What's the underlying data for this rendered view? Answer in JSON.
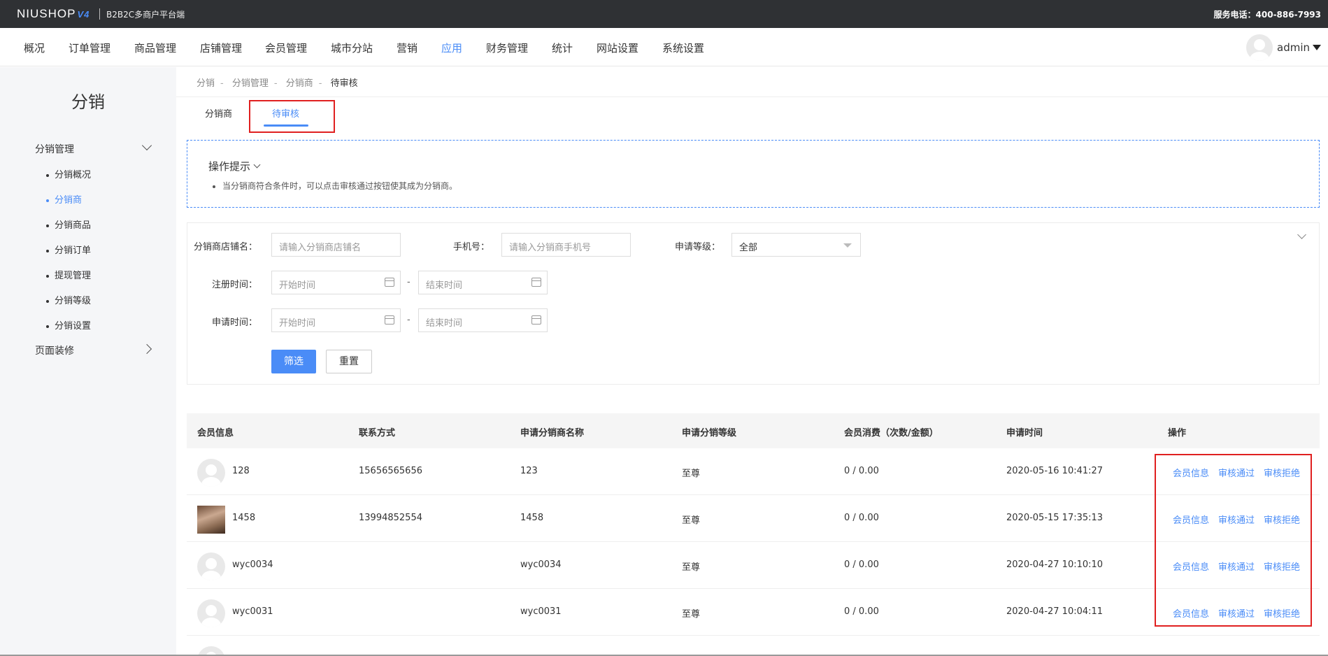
{
  "topbar": {
    "logo": "NIUSHOP",
    "logo_version": "V4",
    "subtitle": "B2B2C多商户平台端",
    "hotline": "服务电话：400-886-7993"
  },
  "nav": {
    "items": [
      "概况",
      "订单管理",
      "商品管理",
      "店铺管理",
      "会员管理",
      "城市分站",
      "营销",
      "应用",
      "财务管理",
      "统计",
      "网站设置",
      "系统设置"
    ],
    "active": "应用",
    "user": "admin"
  },
  "sidebar": {
    "title": "分销",
    "groups": [
      {
        "label": "分销管理",
        "expanded": true,
        "items": [
          "分销概况",
          "分销商",
          "分销商品",
          "分销订单",
          "提现管理",
          "分销等级",
          "分销设置"
        ],
        "active": "分销商"
      },
      {
        "label": "页面装修",
        "expanded": false
      }
    ]
  },
  "breadcrumb": [
    "分销",
    "分销管理",
    "分销商",
    "待审核"
  ],
  "tabs": {
    "items": [
      "分销商",
      "待审核"
    ],
    "active": "待审核"
  },
  "tips": {
    "title": "操作提示",
    "items": [
      "当分销商符合条件时，可以点击审核通过按钮使其成为分销商。"
    ]
  },
  "filter": {
    "shop_name_label": "分销商店铺名：",
    "shop_name_placeholder": "请输入分销商店铺名",
    "phone_label": "手机号：",
    "phone_placeholder": "请输入分销商手机号",
    "level_label": "申请等级：",
    "level_value": "全部",
    "reg_time_label": "注册时间：",
    "apply_time_label": "申请时间：",
    "start_placeholder": "开始时间",
    "end_placeholder": "结束时间",
    "dash": "-",
    "submit": "筛选",
    "reset": "重置"
  },
  "table": {
    "columns": [
      "会员信息",
      "联系方式",
      "申请分销商名称",
      "申请分销等级",
      "会员消费（次数/金额）",
      "申请时间",
      "操作"
    ],
    "actions": [
      "会员信息",
      "审核通过",
      "审核拒绝"
    ],
    "rows": [
      {
        "member": "128",
        "contact": "15656565656",
        "shop": "123",
        "level": "至尊",
        "consume": "0 / 0.00",
        "time": "2020-05-16 10:41:27",
        "photo": false
      },
      {
        "member": "1458",
        "contact": "13994852554",
        "shop": "1458",
        "level": "至尊",
        "consume": "0 / 0.00",
        "time": "2020-05-15 17:35:13",
        "photo": true
      },
      {
        "member": "wyc0034",
        "contact": "",
        "shop": "wyc0034",
        "level": "至尊",
        "consume": "0 / 0.00",
        "time": "2020-04-27 10:10:10",
        "photo": false
      },
      {
        "member": "wyc0031",
        "contact": "",
        "shop": "wyc0031",
        "level": "至尊",
        "consume": "0 / 0.00",
        "time": "2020-04-27 10:04:11",
        "photo": false
      }
    ]
  },
  "colors": {
    "accent": "#4a8cf7",
    "highlight": "#e02020",
    "topbar": "#2f3134"
  }
}
